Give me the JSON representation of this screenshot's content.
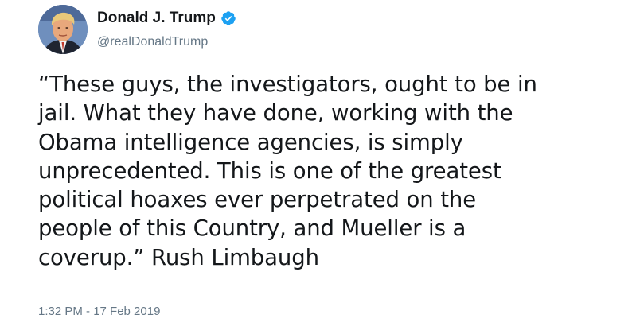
{
  "author": {
    "display_name": "Donald J. Trump",
    "handle": "@realDonaldTrump",
    "verified": true
  },
  "tweet": {
    "text": "“These guys, the investigators, ought to be in\njail. What they have done, working with the\nObama intelligence agencies, is simply\nunprecedented. This is one of the greatest\npolitical hoaxes ever perpetrated on the\npeople of this Country, and Mueller is a\ncoverup.”  Rush Limbaugh",
    "timestamp": "1:32 PM - 17 Feb 2019"
  },
  "icons": {
    "avatar": "profile-photo",
    "verified": "verified-badge-icon"
  },
  "colors": {
    "text": "#14171a",
    "secondary": "#657786",
    "verified_blue": "#1da1f2",
    "background": "#ffffff"
  }
}
